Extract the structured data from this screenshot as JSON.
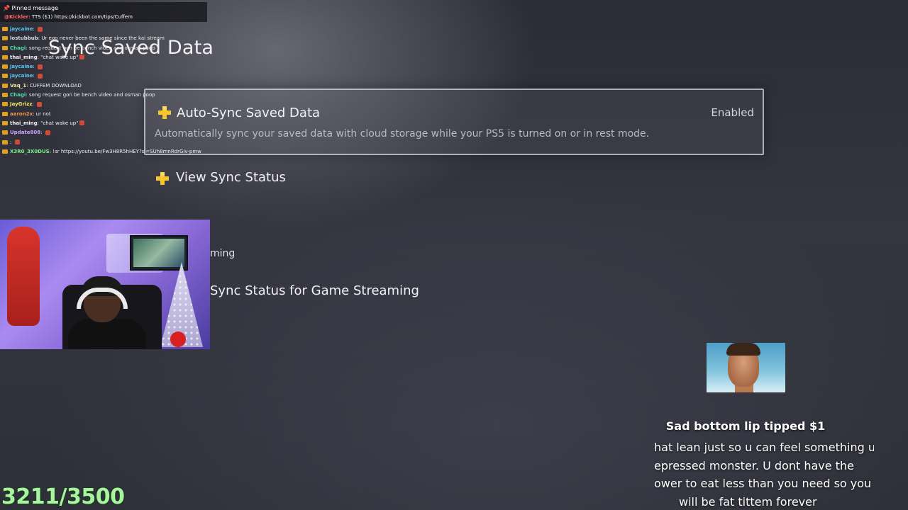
{
  "ps5": {
    "page_title": "Sync Saved Data",
    "auto_sync": {
      "title": "Auto-Sync Saved Data",
      "value": "Enabled",
      "description": "Automatically sync your saved data with cloud storage while your PS5 is turned on or in rest mode."
    },
    "view_sync_status": "View Sync Status",
    "partial_item_1": "ming",
    "partial_item_2": "Sync Status for Game Streaming",
    "icon": "ps-plus-icon",
    "accent_color": "#f6c52b"
  },
  "chat": {
    "pinned_title": "Pinned message",
    "pinned_user": "@Kickler",
    "pinned_text": ": TTS ($1) https://kickbot.com/tips/Cuffem",
    "messages": [
      {
        "user": "jaycaine",
        "text": "",
        "color": "#58c8f0",
        "emote": true
      },
      {
        "user": "lostubbub",
        "text": "Ur ego never been the same since the kai stream",
        "color": "#d9d9e6",
        "emote": false
      },
      {
        "user": "Chagi",
        "text": "song request gon be bench video and osman poop",
        "color": "#4fe0a8",
        "emote": false
      },
      {
        "user": "thai_ming",
        "text": "\"chat wake up\"",
        "color": "#f0f0f0",
        "emote": true
      },
      {
        "user": "jaycaine",
        "text": "",
        "color": "#58c8f0",
        "emote": true
      },
      {
        "user": "jaycaine",
        "text": "",
        "color": "#58c8f0",
        "emote": true
      },
      {
        "user": "Vaq_1",
        "text": "CUFFEM DOWNLOAD",
        "color": "#f0e6a0",
        "emote": false
      },
      {
        "user": "Chagi",
        "text": "song request gon be bench video and osman poop",
        "color": "#4fe0a8",
        "emote": false
      },
      {
        "user": "JayGrizz",
        "text": "",
        "color": "#f4e860",
        "emote": true
      },
      {
        "user": "aaron2x",
        "text": "ur not",
        "color": "#f09a50",
        "emote": false
      },
      {
        "user": "thai_ming",
        "text": "\"chat wake up\"",
        "color": "#f0f0f0",
        "emote": true
      },
      {
        "user": "Update808",
        "text": "",
        "color": "#c9a0ff",
        "emote": true
      },
      {
        "user": "",
        "text": "",
        "color": "#ff4d4d",
        "emote": true
      },
      {
        "user": "X3R0_3X0DUS",
        "text": "!sr https://youtu.be/Fw3H8R5hHEY?si=SUh8mnRdrGiv-pmw",
        "color": "#7df08a",
        "emote": false
      }
    ]
  },
  "tip": {
    "title": "Sad bottom lip tipped $1",
    "lines": [
      "hat lean just so u can feel something u",
      "epressed monster. U dont have the",
      "ower to eat less than you need so you",
      "will be fat tittem forever"
    ]
  },
  "goal": {
    "text": "3211/3500",
    "current": 3211,
    "target": 3500
  }
}
